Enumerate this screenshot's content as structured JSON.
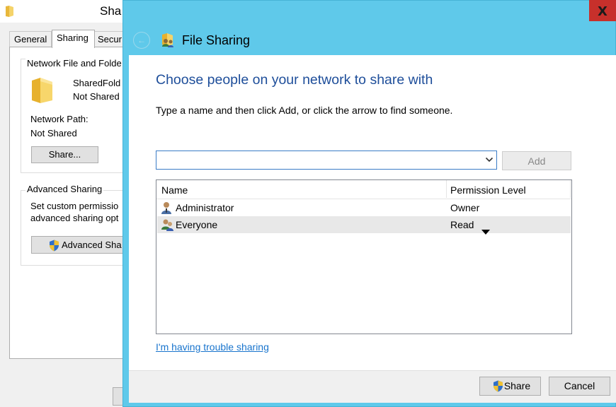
{
  "background_dialog": {
    "title": "Sha",
    "tabs": [
      "General",
      "Sharing",
      "Secur"
    ],
    "active_tab": "Sharing",
    "network_group_label": "Network File and Folde",
    "folder_name": "SharedFold",
    "folder_status": "Not Shared",
    "network_path_label": "Network Path:",
    "network_path_value": "Not Shared",
    "share_button_label": "Share...",
    "advanced_group_label": "Advanced Sharing",
    "advanced_desc_line1": "Set custom permissio",
    "advanced_desc_line2": "advanced sharing opt",
    "advanced_button_label": "Advanced Sha"
  },
  "file_sharing": {
    "window_title": "File Sharing",
    "close_glyph": "X",
    "back_glyph": "←",
    "heading": "Choose people on your network to share with",
    "instruction": "Type a name and then click Add, or click the arrow to find someone.",
    "name_input": {
      "value": "",
      "placeholder": ""
    },
    "add_button_label": "Add",
    "columns": {
      "name": "Name",
      "permission": "Permission Level"
    },
    "rows": [
      {
        "name": "Administrator",
        "permission": "Owner",
        "icon": "user-icon",
        "selected": false
      },
      {
        "name": "Everyone",
        "permission": "Read",
        "icon": "group-users-icon",
        "selected": true
      }
    ],
    "help_link": "I'm having trouble sharing",
    "share_button_label": "Share",
    "cancel_button_label": "Cancel"
  },
  "colors": {
    "window_frame": "#5fc9ea",
    "close_button": "#c7302b",
    "heading_blue": "#1e4e9a",
    "link_blue": "#1874cd"
  }
}
